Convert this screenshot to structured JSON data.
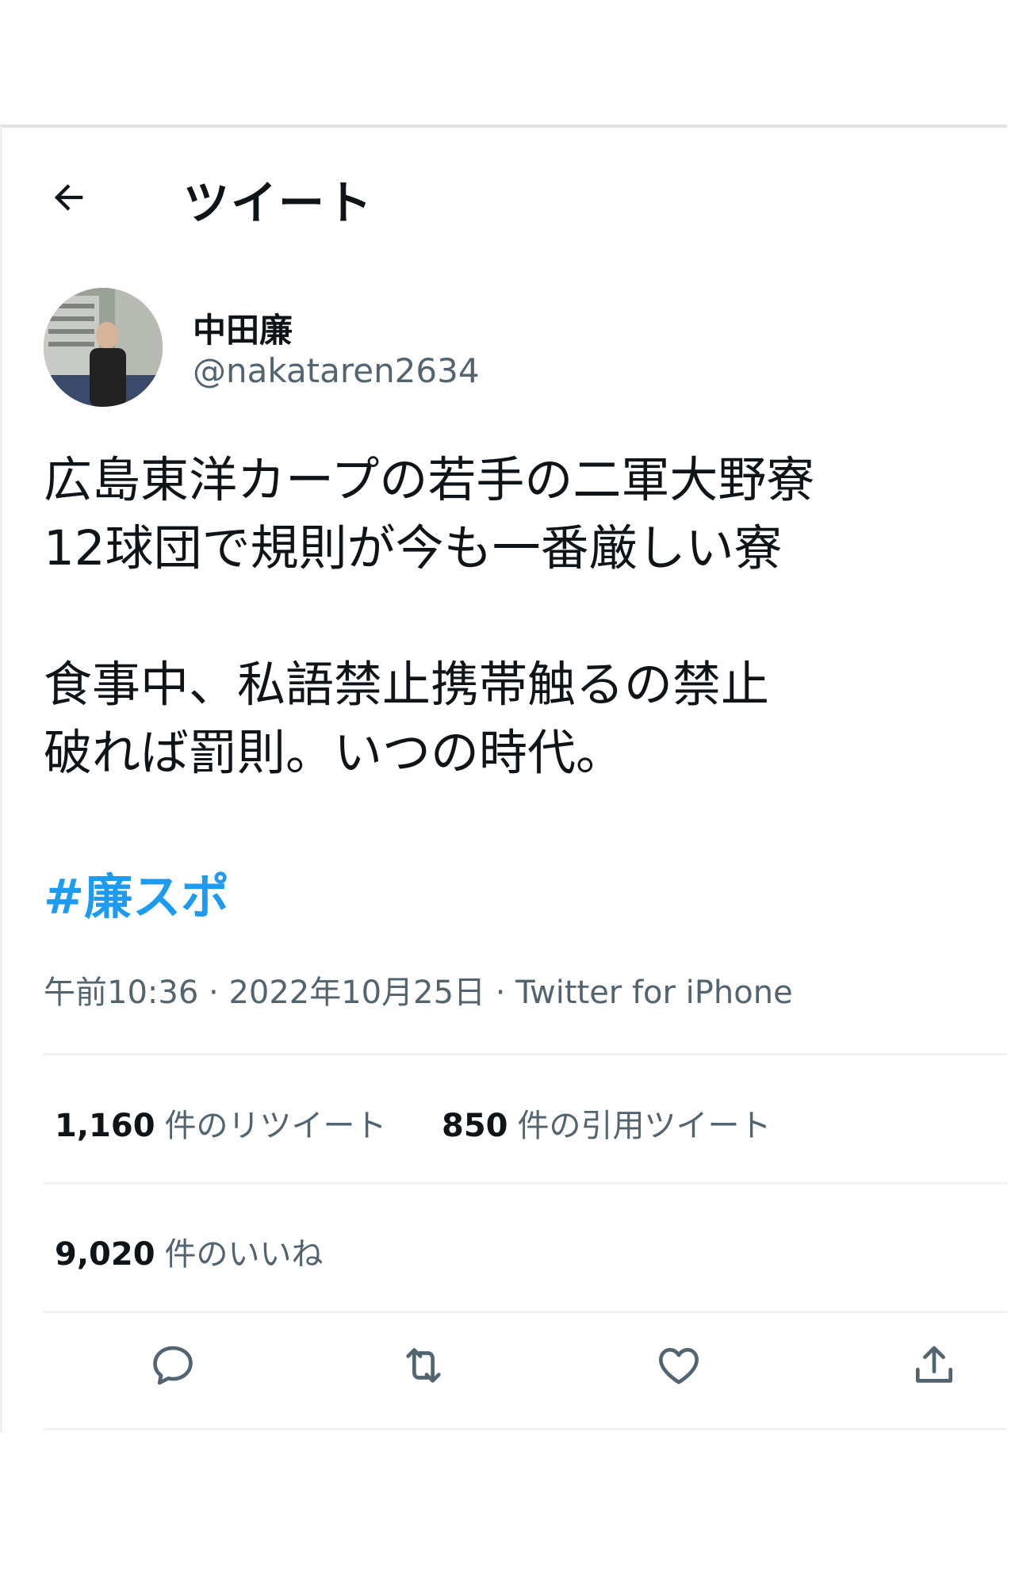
{
  "header": {
    "title": "ツイート",
    "back_icon": "arrow-left-icon"
  },
  "tweet": {
    "display_name": "中田廉",
    "handle": "@nakataren2634",
    "text": "広島東洋カープの若手の二軍大野寮\n12球団で規則が今も一番厳しい寮\n\n食事中、私語禁止携帯触るの禁止\n破れば罰則。いつの時代。",
    "hashtag": "#廉スポ",
    "time": "午前10:36",
    "sep": "·",
    "date": "2022年10月25日",
    "source": "Twitter for iPhone"
  },
  "stats": {
    "retweets_count": "1,160",
    "retweets_label": "件のリツイート",
    "quotes_count": "850",
    "quotes_label": "件の引用ツイート",
    "likes_count": "9,020",
    "likes_label": "件のいいね"
  },
  "actions": [
    "reply-icon",
    "retweet-icon",
    "like-icon",
    "share-icon"
  ],
  "colors": {
    "accent": "#1d9bf0",
    "secondary_text": "#536471",
    "text": "#0f1419",
    "divider": "#eff3f4"
  }
}
